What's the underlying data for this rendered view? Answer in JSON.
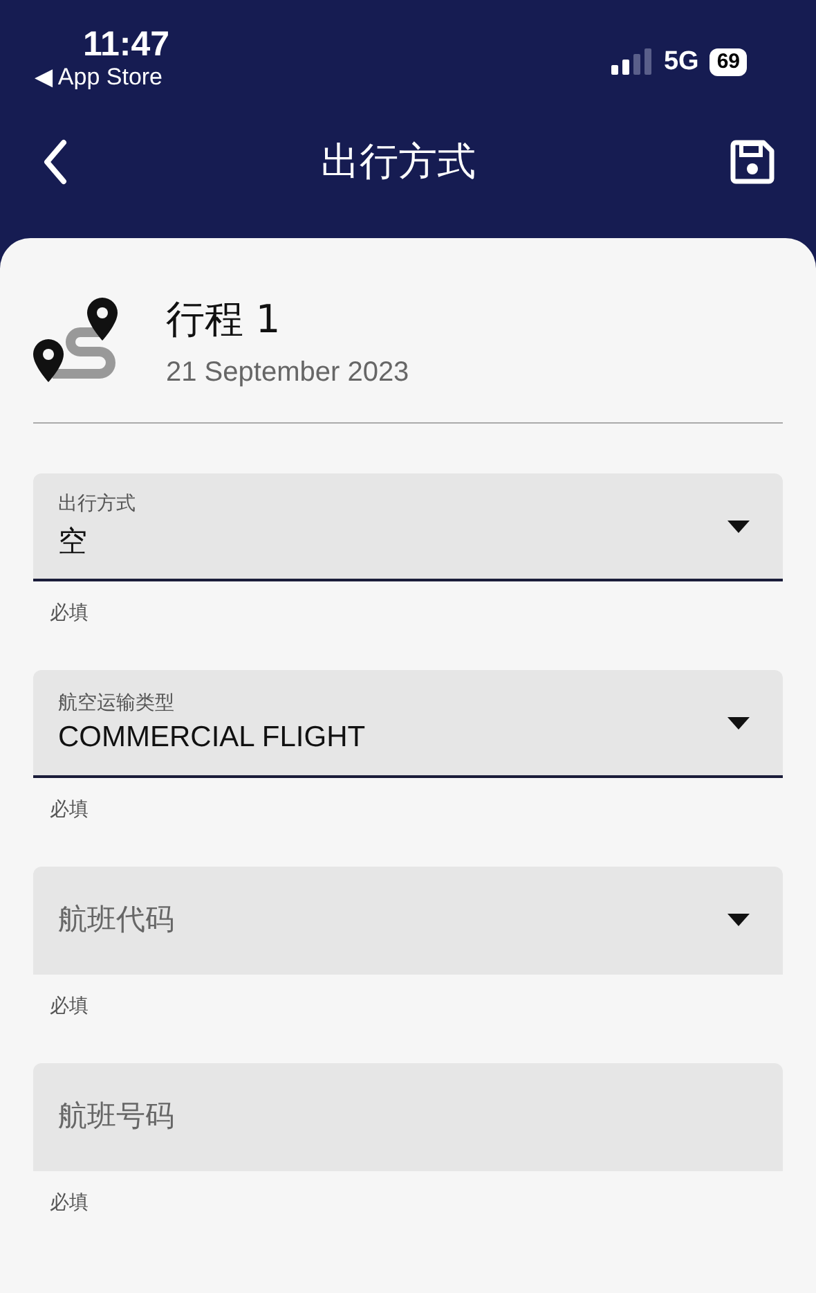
{
  "status_bar": {
    "time": "11:47",
    "back_app": "◀ App Store",
    "network": "5G",
    "battery": "69"
  },
  "nav": {
    "title": "出行方式"
  },
  "trip": {
    "title": "行程 1",
    "date": "21 September 2023"
  },
  "fields": [
    {
      "kind": "select",
      "label": "出行方式",
      "value": "空",
      "helper": "必填"
    },
    {
      "kind": "select",
      "label": "航空运输类型",
      "value": "COMMERCIAL FLIGHT",
      "helper": "必填"
    },
    {
      "kind": "select",
      "placeholder": "航班代码",
      "helper": "必填"
    },
    {
      "kind": "text",
      "placeholder": "航班号码",
      "helper": "必填"
    }
  ]
}
